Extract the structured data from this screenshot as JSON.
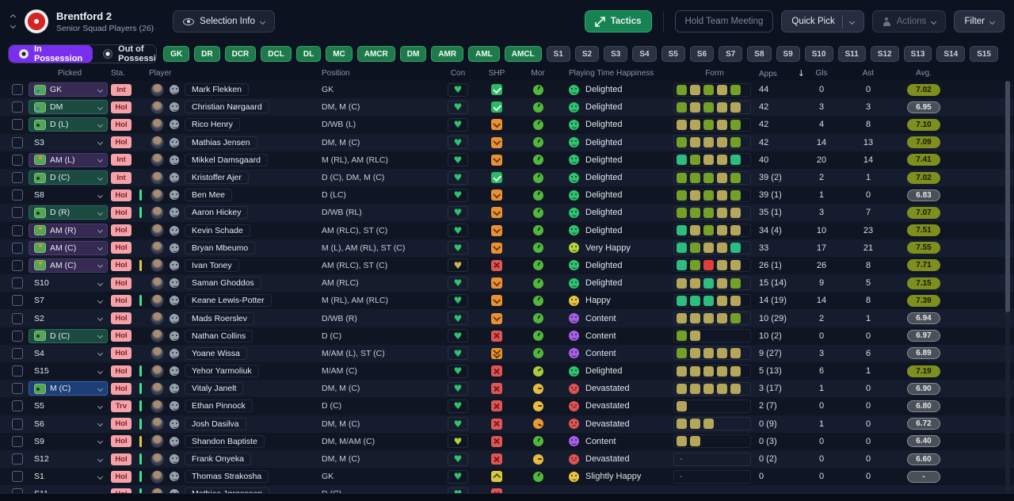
{
  "header": {
    "team_name": "Brentford 2",
    "subtitle": "Senior Squad Players (26)",
    "selection_info_label": "Selection Info",
    "tactics_label": "Tactics",
    "hold_meeting_label": "Hold Team Meeting",
    "quick_pick_label": "Quick Pick",
    "actions_label": "Actions",
    "filter_label": "Filter"
  },
  "possession_tabs": {
    "in_possession": "In Possession",
    "out_of_possession": "Out of Possession"
  },
  "position_filters": {
    "pitch": [
      "GK",
      "DR",
      "DCR",
      "DCL",
      "DL",
      "MC",
      "AMCR",
      "DM",
      "AMR",
      "AML",
      "AMCL"
    ],
    "subs": [
      "S1",
      "S2",
      "S3",
      "S4",
      "S5",
      "S6",
      "S7",
      "S8",
      "S9",
      "S10",
      "S11",
      "S12",
      "S13",
      "S14",
      "S15"
    ]
  },
  "table": {
    "columns": [
      "Picked",
      "Sta.",
      "Player",
      "Position",
      "Con",
      "SHP",
      "Mor",
      "Playing Time Happiness",
      "Form",
      "Apps",
      "Gls",
      "Ast",
      "Avg."
    ],
    "sort_column": "Apps",
    "sort_indicator": "↓",
    "rows": [
      {
        "picked": "GK",
        "picked_style": "purple",
        "shirt_dot": "blue",
        "sta": "Int",
        "stripe": null,
        "player": "Mark Flekken",
        "position": "GK",
        "con": "green",
        "shp": "check",
        "mor": "green",
        "happiness": {
          "label": "Delighted",
          "color": "green"
        },
        "form": [
          "g",
          "k",
          "g",
          "k",
          "g"
        ],
        "apps": "44",
        "gls": "0",
        "ast": "0",
        "avg": {
          "value": "7.02",
          "tone": "olive"
        }
      },
      {
        "picked": "DM",
        "picked_style": "teal",
        "shirt_dot": "blue",
        "sta": "Hol",
        "stripe": null,
        "player": "Christian Nørgaard",
        "position": "DM, M (C)",
        "con": "green",
        "shp": "check",
        "mor": "green",
        "happiness": {
          "label": "Delighted",
          "color": "green"
        },
        "form": [
          "g",
          "k",
          "g",
          "k",
          "k"
        ],
        "apps": "42",
        "gls": "3",
        "ast": "3",
        "avg": {
          "value": "6.95",
          "tone": "grey"
        }
      },
      {
        "picked": "D (L)",
        "picked_style": "teal",
        "shirt_dot": "dark",
        "sta": "Hol",
        "stripe": null,
        "player": "Rico Henry",
        "position": "D/WB (L)",
        "con": "green",
        "shp": "down",
        "mor": "green",
        "happiness": {
          "label": "Delighted",
          "color": "green"
        },
        "form": [
          "k",
          "k",
          "g",
          "k",
          "g"
        ],
        "apps": "42",
        "gls": "4",
        "ast": "8",
        "avg": {
          "value": "7.10",
          "tone": "olive"
        }
      },
      {
        "picked": "S3",
        "picked_style": "sub",
        "shirt_dot": null,
        "sta": "Hol",
        "stripe": null,
        "player": "Mathias Jensen",
        "position": "DM, M (C)",
        "con": "green",
        "shp": "down",
        "mor": "green",
        "happiness": {
          "label": "Delighted",
          "color": "green"
        },
        "form": [
          "g",
          "k",
          "k",
          "k",
          "g"
        ],
        "apps": "42",
        "gls": "14",
        "ast": "13",
        "avg": {
          "value": "7.09",
          "tone": "olive"
        }
      },
      {
        "picked": "AM (L)",
        "picked_style": "purple",
        "shirt_dot": "orange",
        "sta": "Int",
        "stripe": null,
        "player": "Mikkel Damsgaard",
        "position": "M (RL), AM (RLC)",
        "con": "green",
        "shp": "down",
        "mor": "green",
        "happiness": {
          "label": "Delighted",
          "color": "green"
        },
        "form": [
          "t",
          "g",
          "k",
          "k",
          "t"
        ],
        "apps": "40",
        "gls": "20",
        "ast": "14",
        "avg": {
          "value": "7.41",
          "tone": "olive"
        }
      },
      {
        "picked": "D (C)",
        "picked_style": "teal",
        "shirt_dot": "dark",
        "sta": "Int",
        "stripe": null,
        "player": "Kristoffer Ajer",
        "position": "D (C), DM, M (C)",
        "con": "green",
        "shp": "check",
        "mor": "green",
        "happiness": {
          "label": "Delighted",
          "color": "green"
        },
        "form": [
          "g",
          "g",
          "g",
          "k",
          "g"
        ],
        "apps": "39 (2)",
        "gls": "2",
        "ast": "1",
        "avg": {
          "value": "7.02",
          "tone": "olive"
        }
      },
      {
        "picked": "S8",
        "picked_style": "sub",
        "shirt_dot": null,
        "sta": "Hol",
        "stripe": "green",
        "player": "Ben Mee",
        "position": "D (LC)",
        "con": "green",
        "shp": "down",
        "mor": "green",
        "happiness": {
          "label": "Delighted",
          "color": "green"
        },
        "form": [
          "g",
          "k",
          "g",
          "k",
          "g"
        ],
        "apps": "39 (1)",
        "gls": "1",
        "ast": "0",
        "avg": {
          "value": "6.83",
          "tone": "grey"
        }
      },
      {
        "picked": "D (R)",
        "picked_style": "teal",
        "shirt_dot": "dark",
        "sta": "Hol",
        "stripe": "green",
        "player": "Aaron Hickey",
        "position": "D/WB (RL)",
        "con": "green",
        "shp": "down",
        "mor": "green",
        "happiness": {
          "label": "Delighted",
          "color": "green"
        },
        "form": [
          "g",
          "g",
          "g",
          "k",
          "k"
        ],
        "apps": "35 (1)",
        "gls": "3",
        "ast": "7",
        "avg": {
          "value": "7.07",
          "tone": "olive"
        }
      },
      {
        "picked": "AM (R)",
        "picked_style": "purple",
        "shirt_dot": "orange",
        "sta": "Hol",
        "stripe": null,
        "player": "Kevin Schade",
        "position": "AM (RLC), ST (C)",
        "con": "green",
        "shp": "down",
        "mor": "green",
        "happiness": {
          "label": "Delighted",
          "color": "green"
        },
        "form": [
          "t",
          "k",
          "g",
          "k",
          "k"
        ],
        "apps": "34 (4)",
        "gls": "10",
        "ast": "23",
        "avg": {
          "value": "7.51",
          "tone": "olive"
        }
      },
      {
        "picked": "AM (C)",
        "picked_style": "purple",
        "shirt_dot": "orange",
        "sta": "Hol",
        "stripe": null,
        "player": "Bryan Mbeumo",
        "position": "M (L), AM (RL), ST (C)",
        "con": "green",
        "shp": "down",
        "mor": "green",
        "happiness": {
          "label": "Very Happy",
          "color": "lime"
        },
        "form": [
          "t",
          "g",
          "k",
          "k",
          "t"
        ],
        "apps": "33",
        "gls": "17",
        "ast": "21",
        "avg": {
          "value": "7.55",
          "tone": "olive"
        }
      },
      {
        "picked": "AM (C)",
        "picked_style": "purple",
        "shirt_dot": "orange",
        "sta": "Hol",
        "stripe": "yellow",
        "player": "Ivan Toney",
        "position": "AM (RLC), ST (C)",
        "con": "gold",
        "shp": "x",
        "mor": "green",
        "happiness": {
          "label": "Delighted",
          "color": "green"
        },
        "form": [
          "t",
          "g",
          "r",
          "k",
          "k"
        ],
        "apps": "26 (1)",
        "gls": "26",
        "ast": "8",
        "avg": {
          "value": "7.71",
          "tone": "olive"
        }
      },
      {
        "picked": "S10",
        "picked_style": "sub",
        "shirt_dot": null,
        "sta": "Hol",
        "stripe": null,
        "player": "Saman Ghoddos",
        "position": "AM (RLC)",
        "con": "green",
        "shp": "down",
        "mor": "green",
        "happiness": {
          "label": "Delighted",
          "color": "green"
        },
        "form": [
          "k",
          "k",
          "t",
          "k",
          "g"
        ],
        "apps": "15 (14)",
        "gls": "9",
        "ast": "5",
        "avg": {
          "value": "7.15",
          "tone": "olive"
        }
      },
      {
        "picked": "S7",
        "picked_style": "sub",
        "shirt_dot": null,
        "sta": "Hol",
        "stripe": "green",
        "player": "Keane Lewis-Potter",
        "position": "M (RL), AM (RLC)",
        "con": "green",
        "shp": "down",
        "mor": "green",
        "happiness": {
          "label": "Happy",
          "color": "yellow"
        },
        "form": [
          "t",
          "t",
          "t",
          "k",
          "k"
        ],
        "apps": "14 (19)",
        "gls": "14",
        "ast": "8",
        "avg": {
          "value": "7.39",
          "tone": "olive"
        }
      },
      {
        "picked": "S2",
        "picked_style": "sub",
        "shirt_dot": null,
        "sta": "Hol",
        "stripe": null,
        "player": "Mads Roerslev",
        "position": "D/WB (R)",
        "con": "green",
        "shp": "down",
        "mor": "green",
        "happiness": {
          "label": "Content",
          "color": "purple"
        },
        "form": [
          "k",
          "k",
          "k",
          "k",
          "g"
        ],
        "apps": "10 (29)",
        "gls": "2",
        "ast": "1",
        "avg": {
          "value": "6.94",
          "tone": "grey"
        }
      },
      {
        "picked": "D (C)",
        "picked_style": "teal",
        "shirt_dot": "dark",
        "sta": "Hol",
        "stripe": null,
        "player": "Nathan Collins",
        "position": "D (C)",
        "con": "green",
        "shp": "x",
        "mor": "green",
        "happiness": {
          "label": "Content",
          "color": "purple"
        },
        "form": [
          "g",
          "k"
        ],
        "apps": "10 (2)",
        "gls": "0",
        "ast": "0",
        "avg": {
          "value": "6.97",
          "tone": "grey"
        }
      },
      {
        "picked": "S4",
        "picked_style": "sub",
        "shirt_dot": null,
        "sta": "Hol",
        "stripe": null,
        "player": "Yoane Wissa",
        "position": "M/AM (L), ST (C)",
        "con": "green",
        "shp": "down2",
        "mor": "green",
        "happiness": {
          "label": "Content",
          "color": "purple"
        },
        "form": [
          "g",
          "k",
          "k",
          "k",
          "k"
        ],
        "apps": "9 (27)",
        "gls": "3",
        "ast": "6",
        "avg": {
          "value": "6.89",
          "tone": "grey"
        }
      },
      {
        "picked": "S15",
        "picked_style": "sub",
        "shirt_dot": null,
        "sta": "Hol",
        "stripe": "green",
        "player": "Yehor Yarmoliuk",
        "position": "M/AM (C)",
        "con": "green",
        "shp": "x",
        "mor": "lime",
        "happiness": {
          "label": "Delighted",
          "color": "green"
        },
        "form": [
          "k",
          "k",
          "k",
          "k",
          "k"
        ],
        "apps": "5 (13)",
        "gls": "6",
        "ast": "1",
        "avg": {
          "value": "7.19",
          "tone": "olive"
        }
      },
      {
        "picked": "M (C)",
        "picked_style": "blue",
        "shirt_dot": "dark",
        "sta": "Hol",
        "stripe": "green",
        "player": "Vitaly Janelt",
        "position": "DM, M (C)",
        "con": "green",
        "shp": "x",
        "mor": "yellow",
        "happiness": {
          "label": "Devastated",
          "color": "red"
        },
        "form": [
          "k",
          "k",
          "k",
          "k",
          "k"
        ],
        "apps": "3 (17)",
        "gls": "1",
        "ast": "0",
        "avg": {
          "value": "6.90",
          "tone": "grey"
        }
      },
      {
        "picked": "S5",
        "picked_style": "sub",
        "shirt_dot": null,
        "sta": "Trv",
        "stripe": "green",
        "player": "Ethan Pinnock",
        "position": "D (C)",
        "con": "green",
        "shp": "x",
        "mor": "yellow",
        "happiness": {
          "label": "Devastated",
          "color": "red"
        },
        "form": [
          "k"
        ],
        "apps": "2 (7)",
        "gls": "0",
        "ast": "0",
        "avg": {
          "value": "6.80",
          "tone": "grey"
        }
      },
      {
        "picked": "S6",
        "picked_style": "sub",
        "shirt_dot": null,
        "sta": "Hol",
        "stripe": "green",
        "player": "Josh Dasilva",
        "position": "DM, M (C)",
        "con": "green",
        "shp": "x",
        "mor": "orange",
        "happiness": {
          "label": "Devastated",
          "color": "red"
        },
        "form": [
          "k",
          "k",
          "k"
        ],
        "apps": "0 (9)",
        "gls": "1",
        "ast": "0",
        "avg": {
          "value": "6.72",
          "tone": "grey"
        }
      },
      {
        "picked": "S9",
        "picked_style": "sub",
        "shirt_dot": null,
        "sta": "Hol",
        "stripe": "yellow",
        "player": "Shandon Baptiste",
        "position": "DM, M/AM (C)",
        "con": "lime",
        "shp": "x",
        "mor": "green",
        "happiness": {
          "label": "Content",
          "color": "purple"
        },
        "form": [
          "k",
          "k"
        ],
        "apps": "0 (3)",
        "gls": "0",
        "ast": "0",
        "avg": {
          "value": "6.40",
          "tone": "grey"
        }
      },
      {
        "picked": "S12",
        "picked_style": "sub",
        "shirt_dot": null,
        "sta": "Hol",
        "stripe": "green",
        "player": "Frank Onyeka",
        "position": "DM, M (C)",
        "con": "green",
        "shp": "x",
        "mor": "yellow",
        "happiness": {
          "label": "Devastated",
          "color": "red"
        },
        "form": "-",
        "apps": "0 (2)",
        "gls": "0",
        "ast": "0",
        "avg": {
          "value": "6.60",
          "tone": "grey"
        }
      },
      {
        "picked": "S1",
        "picked_style": "sub",
        "shirt_dot": null,
        "sta": "Hol",
        "stripe": "green",
        "player": "Thomas Strakosha",
        "position": "GK",
        "con": "green",
        "shp": "up",
        "mor": "green",
        "happiness": {
          "label": "Slightly Happy",
          "color": "yellow"
        },
        "form": "-",
        "apps": "0",
        "gls": "0",
        "ast": "0",
        "avg": {
          "value": "-",
          "tone": "grey"
        }
      },
      {
        "picked": "S11",
        "picked_style": "sub",
        "shirt_dot": null,
        "sta": "Hol",
        "stripe": "green",
        "player": "Mathias Jørgensen",
        "position": "D (C)",
        "con": "green",
        "shp": "x",
        "mor": null,
        "happiness": null,
        "form": null,
        "apps": null,
        "gls": null,
        "ast": null,
        "avg": null
      }
    ]
  },
  "colors": {
    "accent_purple": "#7a2ff0",
    "pitch_button_green": "#1f7a4b",
    "tactics_green": "#178353",
    "status_badge_pink": "#f5a2a8",
    "avg_olive": "#7e8f1e",
    "form_green": "#74a028",
    "form_khaki": "#b4a75a",
    "form_teal": "#2dbd7e",
    "form_red": "#e23c3c"
  }
}
